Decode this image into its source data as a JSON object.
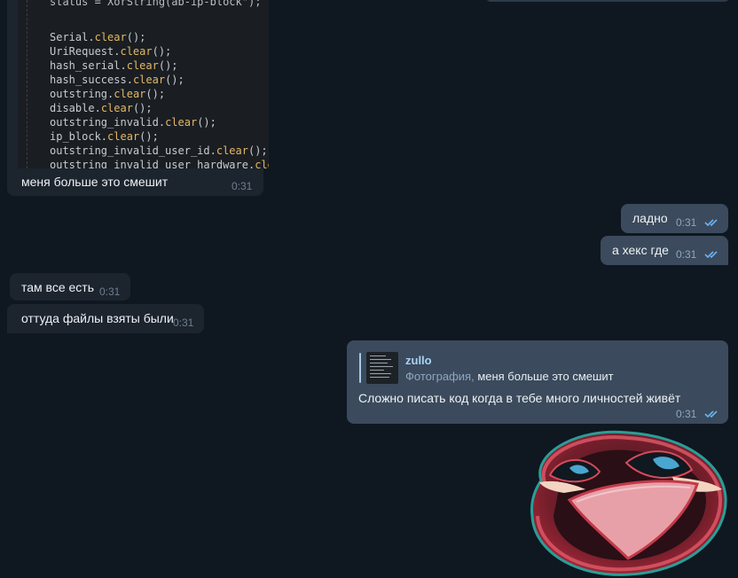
{
  "colors": {
    "background": "#0f1720",
    "incoming_bubble": "#182533",
    "outgoing_bubble": "#2b5278",
    "code_background": "#1a1e22",
    "code_function": "#e3b866",
    "reply_accent": "#a9c7e8",
    "read_check": "#6cb2f0"
  },
  "code_message": {
    "partial_top_line": "status = XorString(ab-ip-block\");",
    "lines": [
      {
        "obj": "Serial",
        "fn": "clear",
        "tail": "();"
      },
      {
        "obj": "UriRequest",
        "fn": "clear",
        "tail": "();"
      },
      {
        "obj": "hash_serial",
        "fn": "clear",
        "tail": "();"
      },
      {
        "obj": "hash_success",
        "fn": "clear",
        "tail": "();"
      },
      {
        "obj": "outstring",
        "fn": "clear",
        "tail": "();"
      },
      {
        "obj": "disable",
        "fn": "clear",
        "tail": "();"
      },
      {
        "obj": "outstring_invalid",
        "fn": "clear",
        "tail": "();"
      },
      {
        "obj": "ip_block",
        "fn": "clear",
        "tail": "();"
      },
      {
        "obj": "outstring_invalid_user_id",
        "fn": "clear",
        "tail": "();"
      },
      {
        "obj": "outstring_invalid_user_hardware",
        "fn": "clea",
        "tail": ""
      }
    ],
    "caption": "меня больше это смешит",
    "time": "0:31"
  },
  "messages": [
    {
      "id": "m1",
      "text": "ладно",
      "time": "0:31",
      "read": true
    },
    {
      "id": "m2",
      "text": "а хекс где",
      "time": "0:31",
      "read": true
    },
    {
      "id": "m3",
      "text": "там все есть",
      "time": "0:31"
    },
    {
      "id": "m4",
      "text": "оттуда файлы взяты были",
      "time": "0:31"
    }
  ],
  "reply_message": {
    "reply_author": "zullo",
    "reply_type_label": "Фотография,",
    "reply_snippet": "меня больше это смешит",
    "text": "Сложно писать код когда в тебе много личностей живёт",
    "time": "0:31",
    "read": true
  },
  "sticker": {
    "icon": "sticker-face-icon",
    "description_colors": [
      "#b32a3a",
      "#e8a0a8",
      "#3c7fa8"
    ]
  }
}
